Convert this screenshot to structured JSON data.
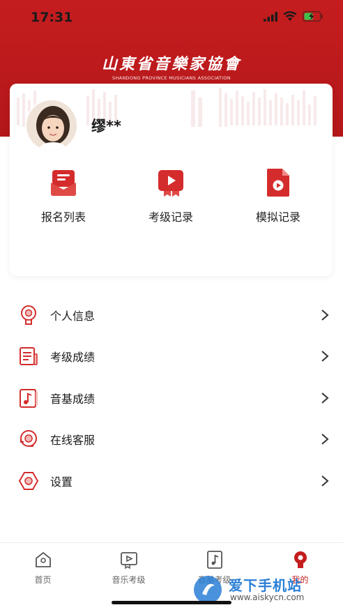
{
  "status_bar": {
    "time": "17:31"
  },
  "header": {
    "logo_cn": "山東省音樂家協會",
    "logo_en": "SHANDONG PROVINCE MUSICIANS ASSOCIATION"
  },
  "profile": {
    "username": "缪**"
  },
  "quick_actions": [
    {
      "label": "报名列表",
      "icon": "registration-list-icon"
    },
    {
      "label": "考级记录",
      "icon": "exam-record-icon"
    },
    {
      "label": "模拟记录",
      "icon": "mock-record-icon"
    }
  ],
  "menu": [
    {
      "label": "个人信息",
      "icon": "personal-info-icon"
    },
    {
      "label": "考级成绩",
      "icon": "exam-score-icon"
    },
    {
      "label": "音基成绩",
      "icon": "music-theory-score-icon"
    },
    {
      "label": "在线客服",
      "icon": "customer-service-icon"
    },
    {
      "label": "设置",
      "icon": "settings-icon"
    }
  ],
  "tabs": [
    {
      "label": "首页",
      "icon": "home-icon",
      "active": false
    },
    {
      "label": "音乐考级",
      "icon": "play-icon",
      "active": false
    },
    {
      "label": "音基考级",
      "icon": "music-note-icon",
      "active": false
    },
    {
      "label": "我的",
      "icon": "profile-icon",
      "active": true
    }
  ],
  "colors": {
    "brand_red": "#c41d1e",
    "text": "#1a1a1a"
  },
  "watermark": {
    "text": "爱下手机站",
    "url": "www.aiskycn.com"
  }
}
